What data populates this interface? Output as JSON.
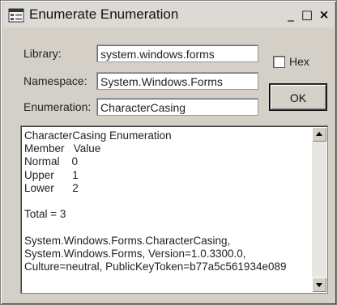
{
  "window": {
    "title": "Enumerate Enumeration",
    "controls": {
      "minimize": "_",
      "maximize": "□",
      "close": "×"
    }
  },
  "form": {
    "library_label": "Library:",
    "library_value": "system.windows.forms",
    "namespace_label": "Namespace:",
    "namespace_value": "System.Windows.Forms",
    "enumeration_label": "Enumeration:",
    "enumeration_value": "CharacterCasing",
    "hex_label": "Hex",
    "hex_checked": false,
    "ok_label": "OK"
  },
  "output": {
    "lines": [
      "CharacterCasing Enumeration",
      "Member   Value",
      "Normal    0",
      "Upper      1",
      "Lower      2",
      "",
      "Total = 3",
      "",
      "System.Windows.Forms.CharacterCasing,",
      "System.Windows.Forms, Version=1.0.3300.0,",
      "Culture=neutral, PublicKeyToken=b77a5c561934e089"
    ]
  },
  "icons": {
    "app": "app-window-icon",
    "scroll_up": "scroll-up-arrow-icon",
    "scroll_down": "scroll-down-arrow-icon"
  }
}
